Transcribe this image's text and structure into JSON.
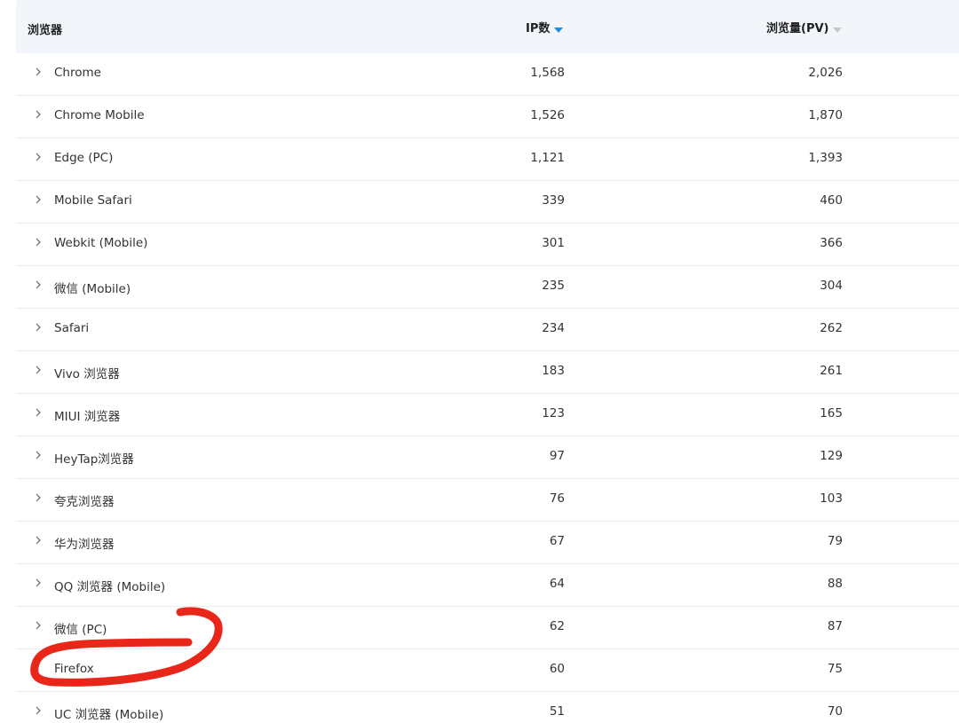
{
  "table": {
    "headers": {
      "browser": "浏览器",
      "ip": "IP数",
      "pv": "浏览量(PV)"
    },
    "rows": [
      {
        "name": "Chrome",
        "ip": "1,568",
        "pv": "2,026",
        "expandable": true
      },
      {
        "name": "Chrome Mobile",
        "ip": "1,526",
        "pv": "1,870",
        "expandable": true
      },
      {
        "name": "Edge (PC)",
        "ip": "1,121",
        "pv": "1,393",
        "expandable": true
      },
      {
        "name": "Mobile Safari",
        "ip": "339",
        "pv": "460",
        "expandable": true
      },
      {
        "name": "Webkit (Mobile)",
        "ip": "301",
        "pv": "366",
        "expandable": true
      },
      {
        "name": "微信 (Mobile)",
        "ip": "235",
        "pv": "304",
        "expandable": true
      },
      {
        "name": "Safari",
        "ip": "234",
        "pv": "262",
        "expandable": true
      },
      {
        "name": "Vivo 浏览器",
        "ip": "183",
        "pv": "261",
        "expandable": true
      },
      {
        "name": "MIUI 浏览器",
        "ip": "123",
        "pv": "165",
        "expandable": true
      },
      {
        "name": "HeyTap浏览器",
        "ip": "97",
        "pv": "129",
        "expandable": true
      },
      {
        "name": "夸克浏览器",
        "ip": "76",
        "pv": "103",
        "expandable": true
      },
      {
        "name": "华为浏览器",
        "ip": "67",
        "pv": "79",
        "expandable": true
      },
      {
        "name": "QQ 浏览器 (Mobile)",
        "ip": "64",
        "pv": "88",
        "expandable": true
      },
      {
        "name": "微信 (PC)",
        "ip": "62",
        "pv": "87",
        "expandable": true
      },
      {
        "name": "Firefox",
        "ip": "60",
        "pv": "75",
        "expandable": false
      },
      {
        "name": "UC 浏览器 (Mobile)",
        "ip": "51",
        "pv": "70",
        "expandable": true
      }
    ]
  },
  "sort": {
    "active_column": "ip",
    "direction": "descending"
  },
  "colors": {
    "header_bg": "#f2f5f9",
    "sort_active": "#1e88e5",
    "sort_inactive": "#c8c8c8",
    "annotation": "#e8261a"
  },
  "icons": {
    "row_expand": "chevron-right-icon",
    "sort": "caret-down-icon"
  }
}
